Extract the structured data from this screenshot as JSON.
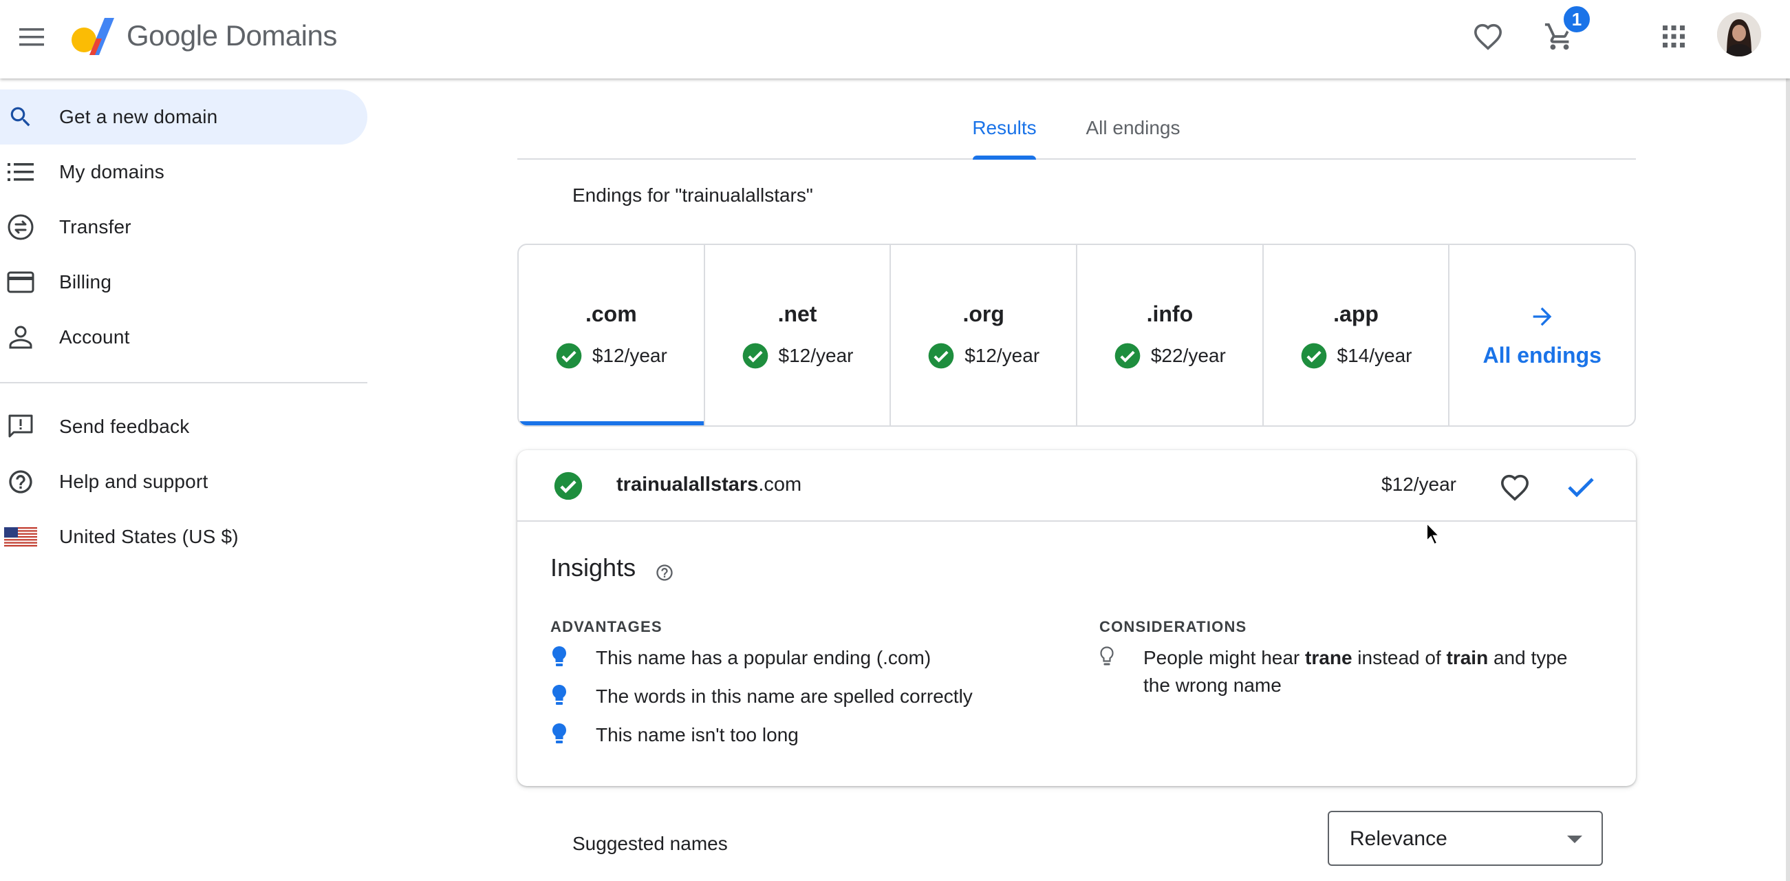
{
  "header": {
    "brand_google": "Google",
    "brand_product": "Domains",
    "cart_count": "1",
    "icons": [
      "menu-icon",
      "favorite-icon",
      "cart-icon",
      "apps-icon"
    ]
  },
  "sidebar": {
    "items": [
      {
        "label": "Get a new domain",
        "icon": "search-icon"
      },
      {
        "label": "My domains",
        "icon": "list-icon"
      },
      {
        "label": "Transfer",
        "icon": "transfer-icon"
      },
      {
        "label": "Billing",
        "icon": "credit-card-icon"
      },
      {
        "label": "Account",
        "icon": "person-icon"
      }
    ],
    "secondary": [
      {
        "label": "Send feedback",
        "icon": "feedback-icon"
      },
      {
        "label": "Help and support",
        "icon": "help-icon"
      },
      {
        "label": "United States (US $)",
        "icon": "us-flag-icon"
      }
    ]
  },
  "tabs": [
    {
      "label": "Results",
      "active": true
    },
    {
      "label": "All endings",
      "active": false
    }
  ],
  "endings_title": "Endings for \"trainualallstars\"",
  "endings": [
    {
      "tld": ".com",
      "price": "$12/year",
      "selected": true
    },
    {
      "tld": ".net",
      "price": "$12/year"
    },
    {
      "tld": ".org",
      "price": "$12/year"
    },
    {
      "tld": ".info",
      "price": "$22/year"
    },
    {
      "tld": ".app",
      "price": "$14/year"
    }
  ],
  "all_endings_label": "All endings",
  "result": {
    "name": "trainualallstars",
    "tld": ".com",
    "price": "$12/year"
  },
  "insights": {
    "title": "Insights",
    "advantages_label": "ADVANTAGES",
    "advantages": [
      "This name has a popular ending (.com)",
      "The words in this name are spelled correctly",
      "This name isn't too long"
    ],
    "considerations_label": "CONSIDERATIONS",
    "consideration": {
      "part1": "People might hear ",
      "bold1": "trane",
      "part2": " instead of ",
      "bold2": "train",
      "part3": " and type",
      "line2": "the wrong name"
    }
  },
  "suggested_label": "Suggested names",
  "sort": {
    "selected": "Relevance"
  },
  "colors": {
    "accent": "#1a73e8",
    "available_green": "#1e8e3e",
    "sidebar_active": "#e8f0fe"
  }
}
